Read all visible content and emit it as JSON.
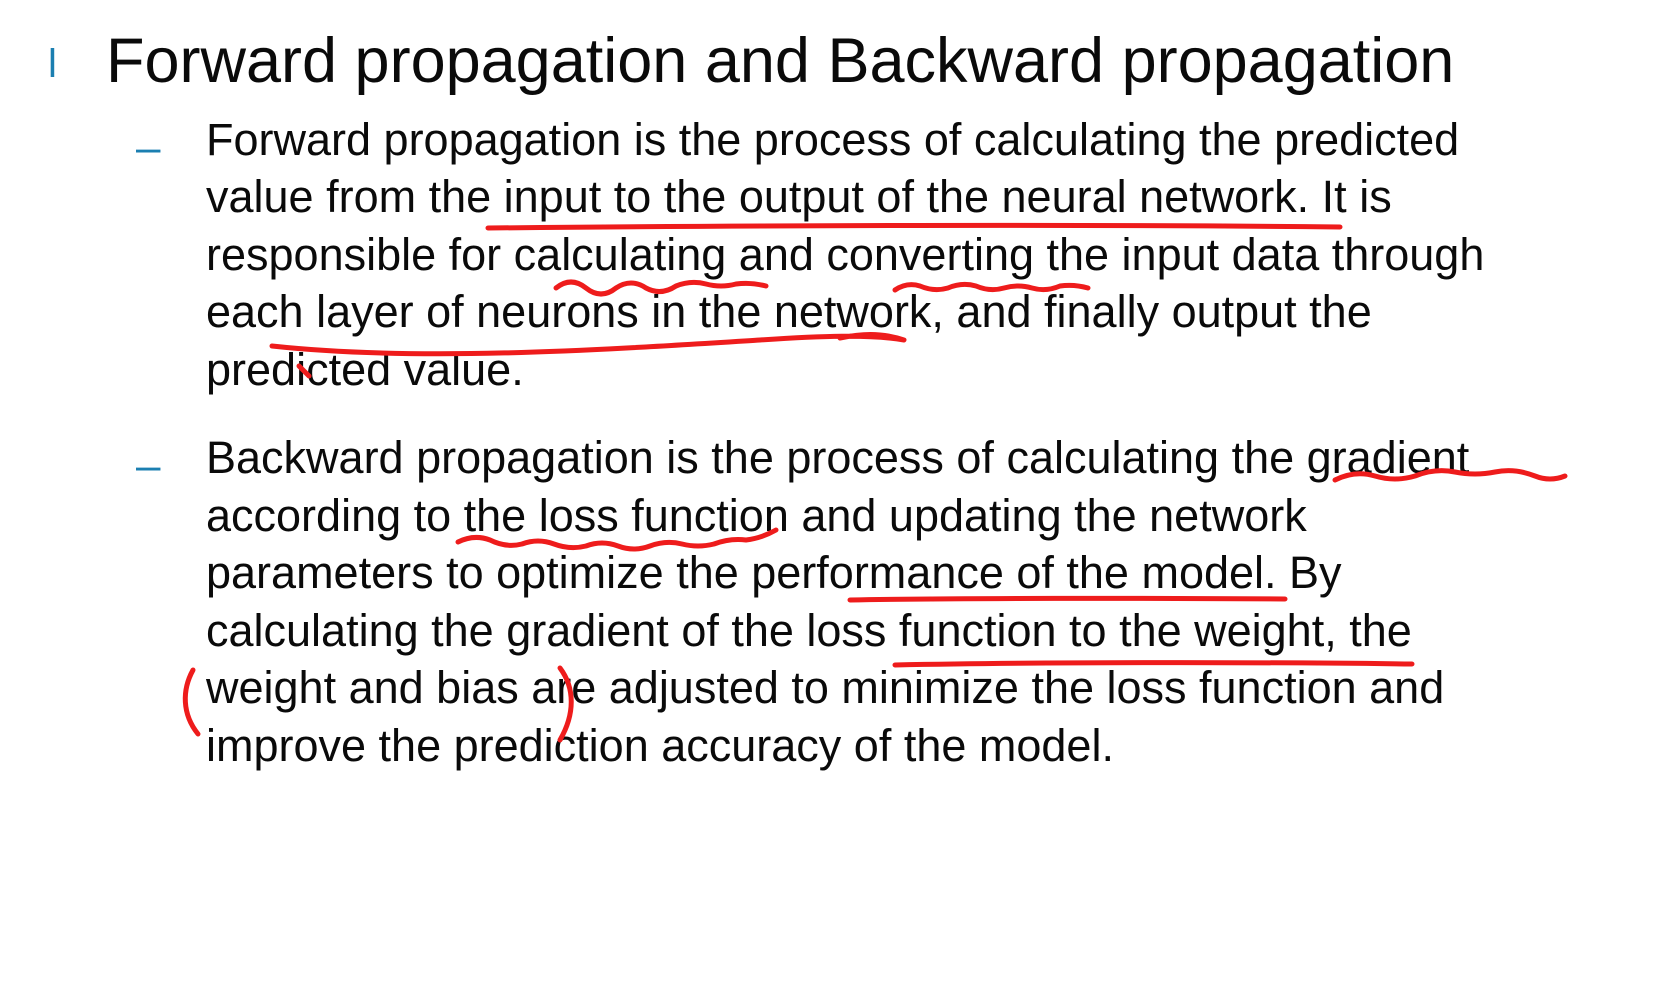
{
  "slide": {
    "title_bullet": "l",
    "title": "Forward propagation and Backward propagation",
    "items": [
      {
        "dash": "–",
        "lines": [
          "Forward propagation is the process of calculating the predicted",
          "value from the input to the output of the neural network. It is",
          "responsible for calculating and converting the input data through",
          "each layer of neurons in the network, and finally output the",
          "predicted value."
        ]
      },
      {
        "dash": "–",
        "lines": [
          "Backward propagation is the process of calculating the gradient",
          "according to the loss function and updating the network",
          "parameters to optimize the performance of the model. By",
          "calculating the gradient of the loss function to the weight, the",
          "weight and bias are adjusted to minimize the loss function and",
          "improve the prediction accuracy of the model."
        ]
      }
    ],
    "annotation_color": "#ee1c1c",
    "accent_color": "#1b7fb1"
  }
}
